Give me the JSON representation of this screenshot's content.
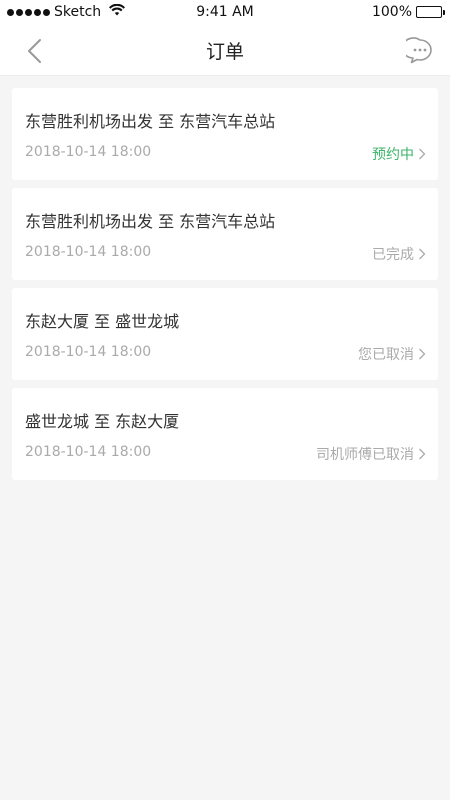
{
  "status_bar": {
    "carrier": "Sketch",
    "time": "9:41 AM",
    "battery": "100%"
  },
  "nav": {
    "title": "订单",
    "back_icon": "chevron-left-icon",
    "message_icon": "chat-bubble-icon"
  },
  "orders": [
    {
      "route": "东营胜利机场出发 至 东营汽车总站",
      "time": "2018-10-14 18:00",
      "status": "预约中"
    },
    {
      "route": "东营胜利机场出发 至 东营汽车总站",
      "time": "2018-10-14 18:00",
      "status": "已完成"
    },
    {
      "route": "东赵大厦 至 盛世龙城",
      "time": "2018-10-14 18:00",
      "status": "您已取消"
    },
    {
      "route": "盛世龙城 至 东赵大厦",
      "time": "2018-10-14 18:00",
      "status": "司机师傅已取消"
    }
  ],
  "colors": {
    "accent_green": "#3bb46a",
    "muted_gray": "#aaaaaa",
    "background": "#f5f5f5"
  }
}
